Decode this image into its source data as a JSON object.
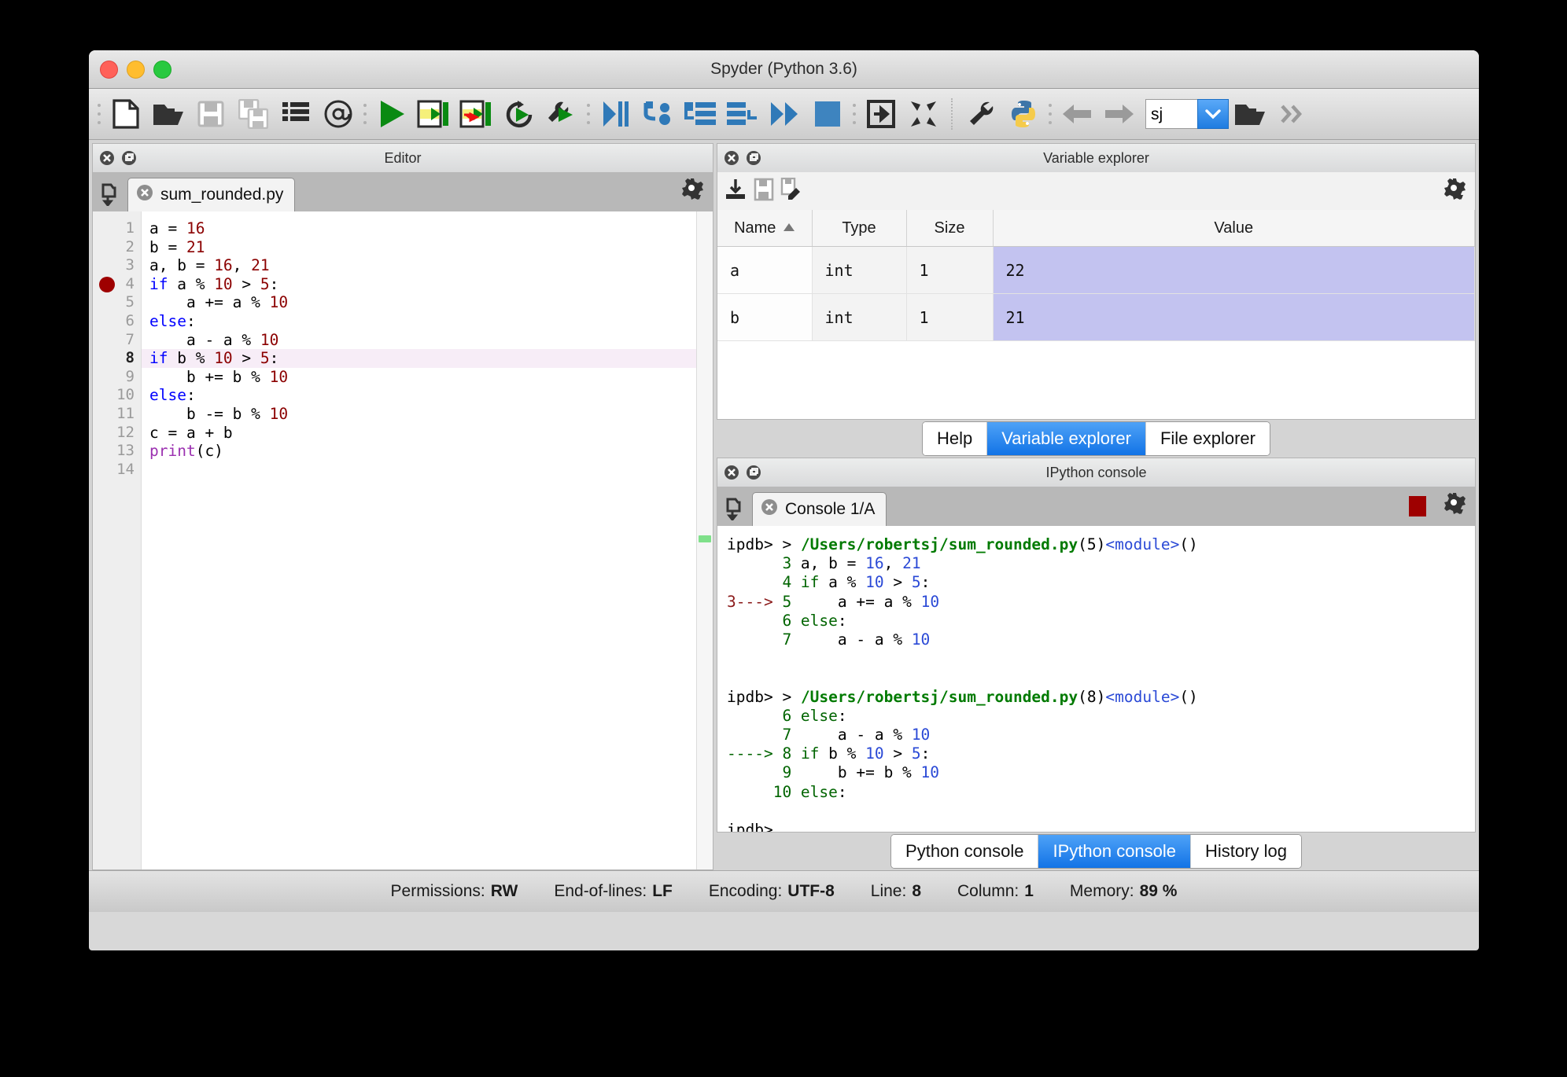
{
  "window": {
    "title": "Spyder (Python 3.6)",
    "traffic_lights": [
      "close",
      "minimize",
      "maximize"
    ]
  },
  "toolbar": {
    "items": [
      {
        "name": "new-file-icon",
        "label": "New file"
      },
      {
        "name": "open-file-icon",
        "label": "Open file"
      },
      {
        "name": "save-file-icon",
        "label": "Save file"
      },
      {
        "name": "save-all-icon",
        "label": "Save all"
      },
      {
        "name": "file-switcher-icon",
        "label": "File switcher"
      },
      {
        "name": "at-symbol-icon",
        "label": "Find symbol"
      },
      {
        "name": "run-file-icon",
        "label": "Run file"
      },
      {
        "name": "run-cell-icon",
        "label": "Run cell"
      },
      {
        "name": "run-cell-advance-icon",
        "label": "Run cell and advance"
      },
      {
        "name": "re-run-icon",
        "label": "Re-run last cell"
      },
      {
        "name": "run-config-icon",
        "label": "Run settings"
      },
      {
        "name": "debug-file-icon",
        "label": "Debug file"
      },
      {
        "name": "step-into-icon",
        "label": "Step into"
      },
      {
        "name": "step-over-icon",
        "label": "Step over"
      },
      {
        "name": "step-return-icon",
        "label": "Step return"
      },
      {
        "name": "continue-icon",
        "label": "Continue"
      },
      {
        "name": "stop-debug-icon",
        "label": "Stop debugging"
      },
      {
        "name": "maximize-pane-icon",
        "label": "Maximize pane"
      },
      {
        "name": "fullscreen-icon",
        "label": "Fullscreen"
      },
      {
        "name": "preferences-icon",
        "label": "Preferences"
      },
      {
        "name": "pythonpath-icon",
        "label": "PYTHONPATH manager"
      },
      {
        "name": "back-arrow-icon",
        "label": "Previous directory"
      },
      {
        "name": "forward-arrow-icon",
        "label": "Next directory"
      },
      {
        "name": "browse-dir-icon",
        "label": "Browse a working directory"
      },
      {
        "name": "overflow-icon",
        "label": "More"
      }
    ],
    "path_value": "sj"
  },
  "editor": {
    "pane_title": "Editor",
    "tab_label": "sum_rounded.py",
    "breakpoint_line": 4,
    "current_line": 8,
    "lines": [
      {
        "n": 1,
        "tokens": [
          {
            "t": "a = ",
            "c": "tx"
          },
          {
            "t": "16",
            "c": "num"
          }
        ]
      },
      {
        "n": 2,
        "tokens": [
          {
            "t": "b = ",
            "c": "tx"
          },
          {
            "t": "21",
            "c": "num"
          }
        ]
      },
      {
        "n": 3,
        "tokens": [
          {
            "t": "a, b = ",
            "c": "tx"
          },
          {
            "t": "16",
            "c": "num"
          },
          {
            "t": ", ",
            "c": "tx"
          },
          {
            "t": "21",
            "c": "num"
          }
        ]
      },
      {
        "n": 4,
        "tokens": [
          {
            "t": "if",
            "c": "kw"
          },
          {
            "t": " a % ",
            "c": "tx"
          },
          {
            "t": "10",
            "c": "num"
          },
          {
            "t": " > ",
            "c": "tx"
          },
          {
            "t": "5",
            "c": "num"
          },
          {
            "t": ":",
            "c": "tx"
          }
        ]
      },
      {
        "n": 5,
        "tokens": [
          {
            "t": "    a += a % ",
            "c": "tx"
          },
          {
            "t": "10",
            "c": "num"
          }
        ]
      },
      {
        "n": 6,
        "tokens": [
          {
            "t": "else",
            "c": "kw"
          },
          {
            "t": ":",
            "c": "tx"
          }
        ]
      },
      {
        "n": 7,
        "tokens": [
          {
            "t": "    a - a % ",
            "c": "tx"
          },
          {
            "t": "10",
            "c": "num"
          }
        ]
      },
      {
        "n": 8,
        "tokens": [
          {
            "t": "if",
            "c": "kw"
          },
          {
            "t": " b % ",
            "c": "tx"
          },
          {
            "t": "10",
            "c": "num"
          },
          {
            "t": " > ",
            "c": "tx"
          },
          {
            "t": "5",
            "c": "num"
          },
          {
            "t": ":",
            "c": "tx"
          }
        ]
      },
      {
        "n": 9,
        "tokens": [
          {
            "t": "    b += b % ",
            "c": "tx"
          },
          {
            "t": "10",
            "c": "num"
          }
        ]
      },
      {
        "n": 10,
        "tokens": [
          {
            "t": "else",
            "c": "kw"
          },
          {
            "t": ":",
            "c": "tx"
          }
        ]
      },
      {
        "n": 11,
        "tokens": [
          {
            "t": "    b -= b % ",
            "c": "tx"
          },
          {
            "t": "10",
            "c": "num"
          }
        ]
      },
      {
        "n": 12,
        "tokens": [
          {
            "t": "c = a + b",
            "c": "tx"
          }
        ]
      },
      {
        "n": 13,
        "tokens": [
          {
            "t": "print",
            "c": "bi"
          },
          {
            "t": "(c)",
            "c": "tx"
          }
        ]
      },
      {
        "n": 14,
        "tokens": []
      }
    ]
  },
  "variable_explorer": {
    "pane_title": "Variable explorer",
    "toolbar_icons": [
      {
        "name": "import-data-icon",
        "label": "Import data"
      },
      {
        "name": "save-data-icon",
        "label": "Save data"
      },
      {
        "name": "save-data-as-icon",
        "label": "Save data as"
      },
      {
        "name": "options-gear-icon",
        "label": "Options"
      }
    ],
    "columns": [
      "Name",
      "Type",
      "Size",
      "Value"
    ],
    "sorted_by": "Name",
    "rows": [
      {
        "name": "a",
        "type": "int",
        "size": "1",
        "value": "22"
      },
      {
        "name": "b",
        "type": "int",
        "size": "1",
        "value": "21"
      }
    ],
    "value_highlight_color": "#c3c3f0"
  },
  "upper_tabs": {
    "items": [
      "Help",
      "Variable explorer",
      "File explorer"
    ],
    "active": "Variable explorer",
    "active_color": "#1273e6"
  },
  "ipython": {
    "pane_title": "IPython console",
    "tab_label": "Console 1/A",
    "stop_button": "stop-kernel-button",
    "lines": [
      {
        "segs": [
          {
            "t": "ipdb> ",
            "c": "c-prompt"
          },
          {
            "t": "> ",
            "c": "c-txt"
          },
          {
            "t": "/Users/robertsj/sum_rounded.py",
            "c": "c-path"
          },
          {
            "t": "(",
            "c": "c-txt"
          },
          {
            "t": "5",
            "c": "c-txt"
          },
          {
            "t": ")",
            "c": "c-txt"
          },
          {
            "t": "<module>",
            "c": "c-mod"
          },
          {
            "t": "()",
            "c": "c-txt"
          }
        ]
      },
      {
        "segs": [
          {
            "t": "      3 ",
            "c": "c-ln"
          },
          {
            "t": "a, b = ",
            "c": "c-txt"
          },
          {
            "t": "16",
            "c": "c-num"
          },
          {
            "t": ", ",
            "c": "c-txt"
          },
          {
            "t": "21",
            "c": "c-num"
          }
        ]
      },
      {
        "segs": [
          {
            "t": "      4 ",
            "c": "c-ln"
          },
          {
            "t": "if",
            "c": "c-kw"
          },
          {
            "t": " a % ",
            "c": "c-txt"
          },
          {
            "t": "10",
            "c": "c-num"
          },
          {
            "t": " > ",
            "c": "c-txt"
          },
          {
            "t": "5",
            "c": "c-num"
          },
          {
            "t": ":",
            "c": "c-txt"
          }
        ]
      },
      {
        "segs": [
          {
            "t": "3---> ",
            "c": "c-arrow"
          },
          {
            "t": "5",
            "c": "c-ln"
          },
          {
            "t": "     a += a % ",
            "c": "c-txt"
          },
          {
            "t": "10",
            "c": "c-num"
          }
        ]
      },
      {
        "segs": [
          {
            "t": "      6 ",
            "c": "c-ln"
          },
          {
            "t": "else",
            "c": "c-kw"
          },
          {
            "t": ":",
            "c": "c-txt"
          }
        ]
      },
      {
        "segs": [
          {
            "t": "      7 ",
            "c": "c-ln"
          },
          {
            "t": "    a - a % ",
            "c": "c-txt"
          },
          {
            "t": "10",
            "c": "c-num"
          }
        ]
      },
      {
        "segs": [
          {
            "t": "",
            "c": "c-txt"
          }
        ]
      },
      {
        "segs": [
          {
            "t": "",
            "c": "c-txt"
          }
        ]
      },
      {
        "segs": [
          {
            "t": "ipdb> ",
            "c": "c-prompt"
          },
          {
            "t": "> ",
            "c": "c-txt"
          },
          {
            "t": "/Users/robertsj/sum_rounded.py",
            "c": "c-path"
          },
          {
            "t": "(",
            "c": "c-txt"
          },
          {
            "t": "8",
            "c": "c-txt"
          },
          {
            "t": ")",
            "c": "c-txt"
          },
          {
            "t": "<module>",
            "c": "c-mod"
          },
          {
            "t": "()",
            "c": "c-txt"
          }
        ]
      },
      {
        "segs": [
          {
            "t": "      6 ",
            "c": "c-ln"
          },
          {
            "t": "else",
            "c": "c-kw"
          },
          {
            "t": ":",
            "c": "c-txt"
          }
        ]
      },
      {
        "segs": [
          {
            "t": "      7 ",
            "c": "c-ln"
          },
          {
            "t": "    a - a % ",
            "c": "c-txt"
          },
          {
            "t": "10",
            "c": "c-num"
          }
        ]
      },
      {
        "segs": [
          {
            "t": "----> ",
            "c": "c-arrow2"
          },
          {
            "t": "8 ",
            "c": "c-ln"
          },
          {
            "t": "if",
            "c": "c-kw"
          },
          {
            "t": " b % ",
            "c": "c-txt"
          },
          {
            "t": "10",
            "c": "c-num"
          },
          {
            "t": " > ",
            "c": "c-txt"
          },
          {
            "t": "5",
            "c": "c-num"
          },
          {
            "t": ":",
            "c": "c-txt"
          }
        ]
      },
      {
        "segs": [
          {
            "t": "      9 ",
            "c": "c-ln"
          },
          {
            "t": "    b += b % ",
            "c": "c-txt"
          },
          {
            "t": "10",
            "c": "c-num"
          }
        ]
      },
      {
        "segs": [
          {
            "t": "     10 ",
            "c": "c-ln"
          },
          {
            "t": "else",
            "c": "c-kw"
          },
          {
            "t": ":",
            "c": "c-txt"
          }
        ]
      },
      {
        "segs": [
          {
            "t": "",
            "c": "c-txt"
          }
        ]
      },
      {
        "segs": [
          {
            "t": "ipdb>",
            "c": "c-prompt"
          }
        ]
      }
    ]
  },
  "lower_tabs": {
    "items": [
      "Python console",
      "IPython console",
      "History log"
    ],
    "active": "IPython console",
    "active_color": "#1273e6"
  },
  "status_bar": {
    "items": [
      {
        "label": "Permissions:",
        "value": "RW"
      },
      {
        "label": "End-of-lines:",
        "value": "LF"
      },
      {
        "label": "Encoding:",
        "value": "UTF-8"
      },
      {
        "label": "Line:",
        "value": "8"
      },
      {
        "label": "Column:",
        "value": "1"
      },
      {
        "label": "Memory:",
        "value": "89 %"
      }
    ]
  }
}
